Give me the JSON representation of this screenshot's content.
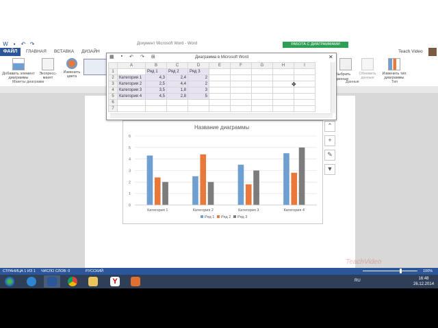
{
  "window": {
    "doc_title": "Документ Microsoft Word - Word",
    "chart_tools_label": "РАБОТА С ДИАГРАММАМИ",
    "user_name": "Teach Video"
  },
  "ribbon_tabs": [
    "ГЛАВНАЯ",
    "ВСТАВКА",
    "ДИЗАЙН"
  ],
  "file_tab": "ФАЙЛ",
  "ribbon": {
    "add_element": "Добавить элемент диаграммы",
    "express_layout": "Экспресс-макет",
    "change_colors": "Изменить цвета",
    "select_data": "Выбрать данные",
    "refresh_data": "Обновить данные",
    "change_type": "Изменить тип диаграммы",
    "group_layouts": "Макеты диаграмм",
    "group_data": "Данные",
    "group_type": "Тип"
  },
  "spreadsheet": {
    "title": "Диаграмма в Microsoft Word",
    "columns": [
      "",
      "A",
      "B",
      "C",
      "D",
      "E",
      "F",
      "G",
      "H",
      "I"
    ],
    "rows": [
      {
        "n": "1",
        "cells": [
          "",
          "Ряд 1",
          "Ряд 2",
          "Ряд 3"
        ]
      },
      {
        "n": "2",
        "cells": [
          "Категория 1",
          "4,3",
          "2,4",
          "2"
        ]
      },
      {
        "n": "3",
        "cells": [
          "Категория 2",
          "2,5",
          "4,4",
          "2"
        ]
      },
      {
        "n": "4",
        "cells": [
          "Категория 3",
          "3,5",
          "1,8",
          "3"
        ]
      },
      {
        "n": "5",
        "cells": [
          "Категория 4",
          "4,5",
          "2,8",
          "5"
        ]
      },
      {
        "n": "6",
        "cells": [
          "",
          "",
          "",
          ""
        ]
      },
      {
        "n": "7",
        "cells": [
          "",
          "",
          "",
          ""
        ]
      }
    ]
  },
  "chart_data": {
    "type": "bar",
    "title": "Название диаграммы",
    "categories": [
      "Категория 1",
      "Категория 2",
      "Категория 3",
      "Категория 4"
    ],
    "series": [
      {
        "name": "Ряд 1",
        "values": [
          4.3,
          2.5,
          3.5,
          4.5
        ],
        "color": "#6f9ed1"
      },
      {
        "name": "Ряд 2",
        "values": [
          2.4,
          4.4,
          1.8,
          2.8
        ],
        "color": "#e8793a"
      },
      {
        "name": "Ряд 3",
        "values": [
          2,
          2,
          3,
          5
        ],
        "color": "#7c7c7c"
      }
    ],
    "yticks": [
      "0",
      "1",
      "2",
      "3",
      "4",
      "5",
      "6"
    ],
    "ylim": [
      0,
      6
    ],
    "grid": true,
    "legend": "bottom",
    "xlabel": "",
    "ylabel": ""
  },
  "status": {
    "page": "СТРАНИЦА 1 ИЗ 1",
    "words": "ЧИСЛО СЛОВ: 0",
    "lang": "РУССКИЙ",
    "zoom": "100%"
  },
  "taskbar": {
    "lang": "RU",
    "time": "16:48",
    "date": "26.12.2014"
  },
  "watermark": "TeachVideo"
}
